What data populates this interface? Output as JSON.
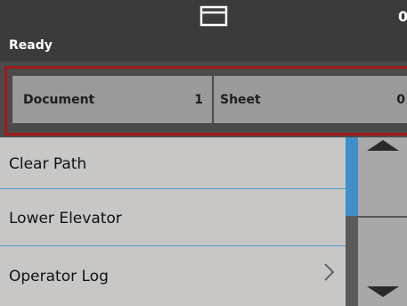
{
  "status": {
    "text": "Ready",
    "count": "0"
  },
  "counters": {
    "document": {
      "label": "Document",
      "value": "1"
    },
    "sheet": {
      "label": "Sheet",
      "value": "0"
    }
  },
  "menu": {
    "items": [
      {
        "label": "Clear Path"
      },
      {
        "label": "Lower Elevator"
      },
      {
        "label": "Operator Log",
        "icon": "chevron-right-icon"
      }
    ]
  },
  "colors": {
    "topbar": "#3b3b3b",
    "highlight": "#a11a1a",
    "list_bg": "#c8c7c5",
    "accent": "#3f8fc9"
  },
  "icons": {
    "tray": "output-tray-icon",
    "scroll_up": "arrow-up-icon",
    "scroll_down": "arrow-down-icon"
  }
}
